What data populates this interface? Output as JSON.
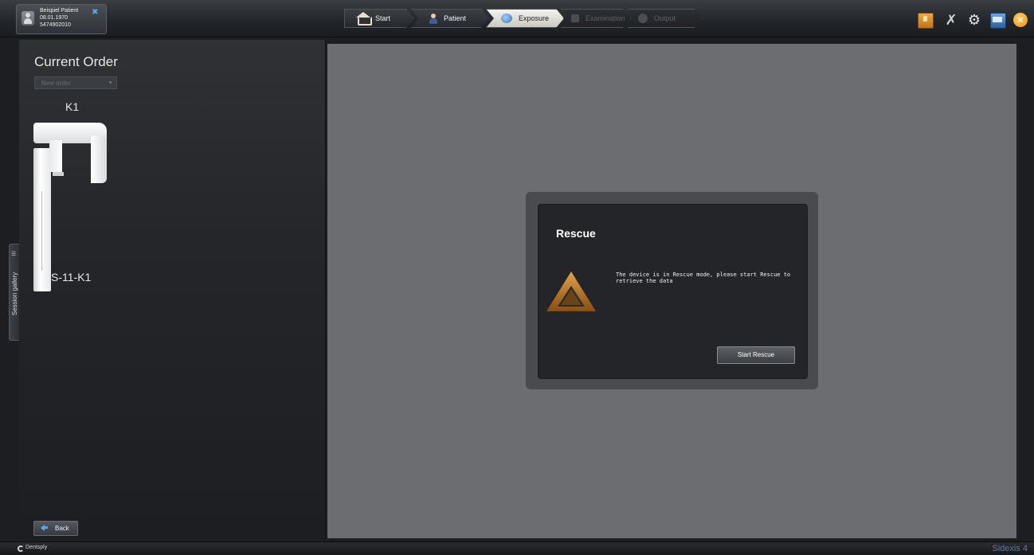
{
  "patient": {
    "name": "Beispiel Patient",
    "birthdate": "08.01.1970",
    "id": "5474902010"
  },
  "workflow": {
    "steps": [
      {
        "label": "Start",
        "icon": "home-icon",
        "state": "normal"
      },
      {
        "label": "Patient",
        "icon": "patient-icon",
        "state": "normal"
      },
      {
        "label": "Exposure",
        "icon": "exposure-icon",
        "state": "active"
      },
      {
        "label": "Examination",
        "icon": "examination-icon",
        "state": "disabled"
      },
      {
        "label": "Output",
        "icon": "output-icon",
        "state": "disabled"
      }
    ]
  },
  "tray_icons": [
    "book-icon",
    "tools-icon",
    "gear-icon",
    "window-icon",
    "close-icon"
  ],
  "left_panel": {
    "title": "Current Order",
    "order_select_placeholder": "New order",
    "device_name": "K1",
    "device_image_icon": "dental-xray-device-icon",
    "order_code": "S-11-K1",
    "back_label": "Back"
  },
  "gallery_tab": {
    "label": "Session gallery"
  },
  "dialog": {
    "title": "Rescue",
    "message": "The device is in Rescue mode, please start Rescue to retrieve the data",
    "button_label": "Start Rescue",
    "icon": "warning-triangle-icon"
  },
  "footer": {
    "brand": "Dentsply",
    "product": "Sidexis 4"
  },
  "colors": {
    "accent_blue": "#5aa8e8",
    "warning_orange": "#c07a1c",
    "workspace_gray": "#6b6d70"
  }
}
